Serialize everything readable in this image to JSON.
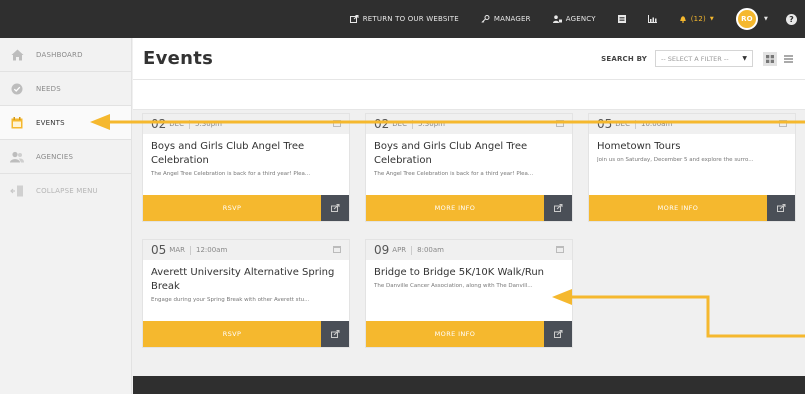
{
  "topbar": {
    "return_label": "RETURN TO OUR WEBSITE",
    "manager_label": "MANAGER",
    "agency_label": "AGENCY",
    "alerts_label": "(12)",
    "avatar_initials": "RO"
  },
  "sidebar": {
    "items": [
      {
        "label": "DASHBOARD",
        "icon": "home-icon"
      },
      {
        "label": "NEEDS",
        "icon": "check-circle-icon"
      },
      {
        "label": "EVENTS",
        "icon": "calendar-icon",
        "active": true
      },
      {
        "label": "AGENCIES",
        "icon": "users-icon"
      },
      {
        "label": "COLLAPSE MENU",
        "icon": "collapse-icon"
      }
    ]
  },
  "main": {
    "title": "Events",
    "search_by_label": "SEARCH BY",
    "filter_value": "-- SELECT A FILTER --"
  },
  "events": [
    {
      "day": "02",
      "month": "DEC",
      "time": "5:30pm",
      "title": "Boys and Girls Club Angel Tree Celebration",
      "desc": "The Angel Tree Celebration is back for a third year! Plea...",
      "button": "RSVP"
    },
    {
      "day": "02",
      "month": "DEC",
      "time": "5:30pm",
      "title": "Boys and Girls Club Angel Tree Celebration",
      "desc": "The Angel Tree Celebration is back for a third year! Plea...",
      "button": "MORE INFO"
    },
    {
      "day": "05",
      "month": "DEC",
      "time": "10:00am",
      "title": "Hometown Tours",
      "desc": "Join us on Saturday, December 5 and explore the surro...",
      "button": "MORE INFO"
    },
    {
      "day": "05",
      "month": "MAR",
      "time": "12:00am",
      "title": "Averett University Alternative Spring Break",
      "desc": "Engage during your Spring Break with other Averett stu...",
      "button": "RSVP"
    },
    {
      "day": "09",
      "month": "APR",
      "time": "8:00am",
      "title": "Bridge to Bridge 5K/10K Walk/Run",
      "desc": "The Danville Cancer Association, along with The Danvill...",
      "button": "MORE INFO"
    }
  ],
  "colors": {
    "accent": "#f5b82e",
    "topbar": "#2f2f2f",
    "share": "#4a4f57"
  }
}
